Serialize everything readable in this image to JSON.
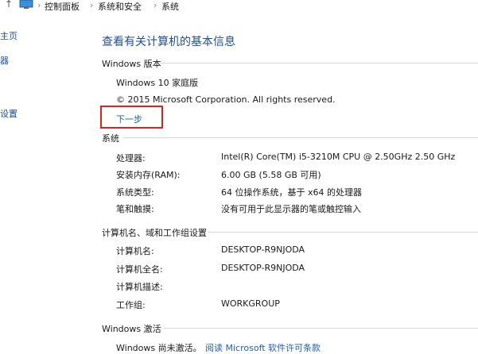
{
  "breadcrumb": {
    "items": [
      "控制面板",
      "系统和安全",
      "系统"
    ],
    "separator": "›"
  },
  "sidebar": {
    "items": [
      "主页",
      "器",
      "设置"
    ]
  },
  "main": {
    "heading": "查看有关计算机的基本信息",
    "windows_edition": {
      "title": "Windows 版本",
      "edition": "Windows 10 家庭版",
      "copyright": "© 2015 Microsoft Corporation. All rights reserved.",
      "next_link": "下一步"
    },
    "system": {
      "title": "系统",
      "rows": [
        {
          "label": "处理器:",
          "value": "Intel(R) Core(TM) i5-3210M CPU @ 2.50GHz   2.50 GHz"
        },
        {
          "label": "安装内存(RAM):",
          "value": "6.00 GB (5.58 GB 可用)"
        },
        {
          "label": "系统类型:",
          "value": "64 位操作系统，基于 x64 的处理器"
        },
        {
          "label": "笔和触摸:",
          "value": "没有可用于此显示器的笔或触控输入"
        }
      ]
    },
    "computer_name": {
      "title": "计算机名、域和工作组设置",
      "rows": [
        {
          "label": "计算机名:",
          "value": "DESKTOP-R9NJODA"
        },
        {
          "label": "计算机全名:",
          "value": "DESKTOP-R9NJODA"
        },
        {
          "label": "计算机描述:",
          "value": ""
        },
        {
          "label": "工作组:",
          "value": "WORKGROUP"
        }
      ]
    },
    "activation": {
      "title": "Windows 激活",
      "status": "Windows 尚未激活。",
      "license_link": "阅读 Microsoft 软件许可条款"
    }
  },
  "colors": {
    "heading": "#1f4e9c",
    "link": "#1f5fbf",
    "highlight_box": "#e0201c"
  }
}
